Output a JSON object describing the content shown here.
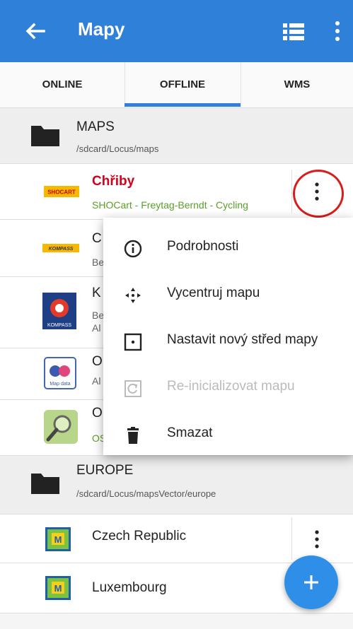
{
  "appbar": {
    "title": "Mapy"
  },
  "tabs": [
    "ONLINE",
    "OFFLINE",
    "WMS"
  ],
  "sections": [
    {
      "title": "MAPS",
      "path": "/sdcard/Locus/maps"
    },
    {
      "title": "EUROPE",
      "path": "/sdcard/Locus/mapsVector/europe"
    }
  ],
  "rows": [
    {
      "name": "Chřiby",
      "sub": "SHOCart - Freytag-Berndt - Cycling",
      "logo": "SHOCART"
    },
    {
      "name": "C",
      "sub": "Be",
      "logo": "KOMPASS"
    },
    {
      "name": "K",
      "sub": "Be",
      "sub2": "Al",
      "logo": "KOMPASS"
    },
    {
      "name": "O",
      "sub": "Al",
      "logo": "Map data"
    },
    {
      "name": "O",
      "sub": "OS",
      "logo": ""
    },
    {
      "name": "Czech Republic"
    },
    {
      "name": "Luxembourg"
    }
  ],
  "menu": [
    {
      "label": "Podrobnosti",
      "icon": "info-icon"
    },
    {
      "label": "Vycentruj mapu",
      "icon": "center-arrows-icon"
    },
    {
      "label": "Nastavit nový střed mapy",
      "icon": "set-center-icon"
    },
    {
      "label": "Re-inicializovat mapu",
      "icon": "reinit-icon",
      "disabled": true
    },
    {
      "label": "Smazat",
      "icon": "trash-icon"
    }
  ],
  "colors": {
    "primary": "#2f80d8",
    "accent_title": "#d0021b",
    "green": "#5aa028",
    "annotation": "#d81d1d"
  }
}
